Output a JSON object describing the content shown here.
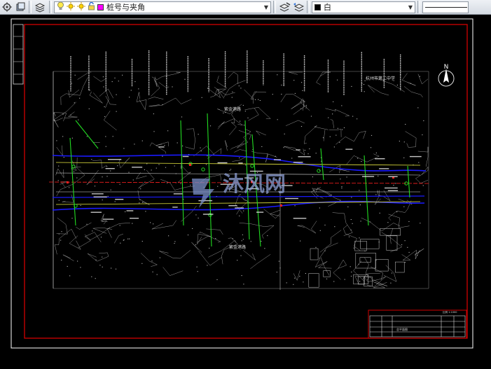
{
  "toolbar": {
    "layer_name": "桩号与夹角",
    "color_name": "白",
    "layer_swatch_color": "#ff00ff",
    "color_swatch_color": "#000000"
  },
  "icons": {
    "settings": "gear-icon",
    "layer_state": "layer-state-icon",
    "layer_props": "layers-icon",
    "light": "bulb-icon",
    "sun": "sun-icon",
    "lock": "lock-icon",
    "match": "match-layer-icon",
    "previous": "layer-previous-icon",
    "dropdown": "chevron-down-icon"
  },
  "drawing": {
    "north_label": "N",
    "header_note": "杭州市第二中学",
    "watermark": "沐风网",
    "label_a": "紫金港路",
    "label_b": "紫金港路",
    "title_block_label": "总平面图",
    "scale_label": "比例 1:1000"
  },
  "colors": {
    "frame_red": "#d10000",
    "outer_white": "#ffffff",
    "pipe_blue": "#1a1aff",
    "pipe_green": "#22dd22",
    "pipe_yellow": "#e8e840",
    "pipe_red": "#ff2020",
    "terrain": "#cfcfcf"
  }
}
